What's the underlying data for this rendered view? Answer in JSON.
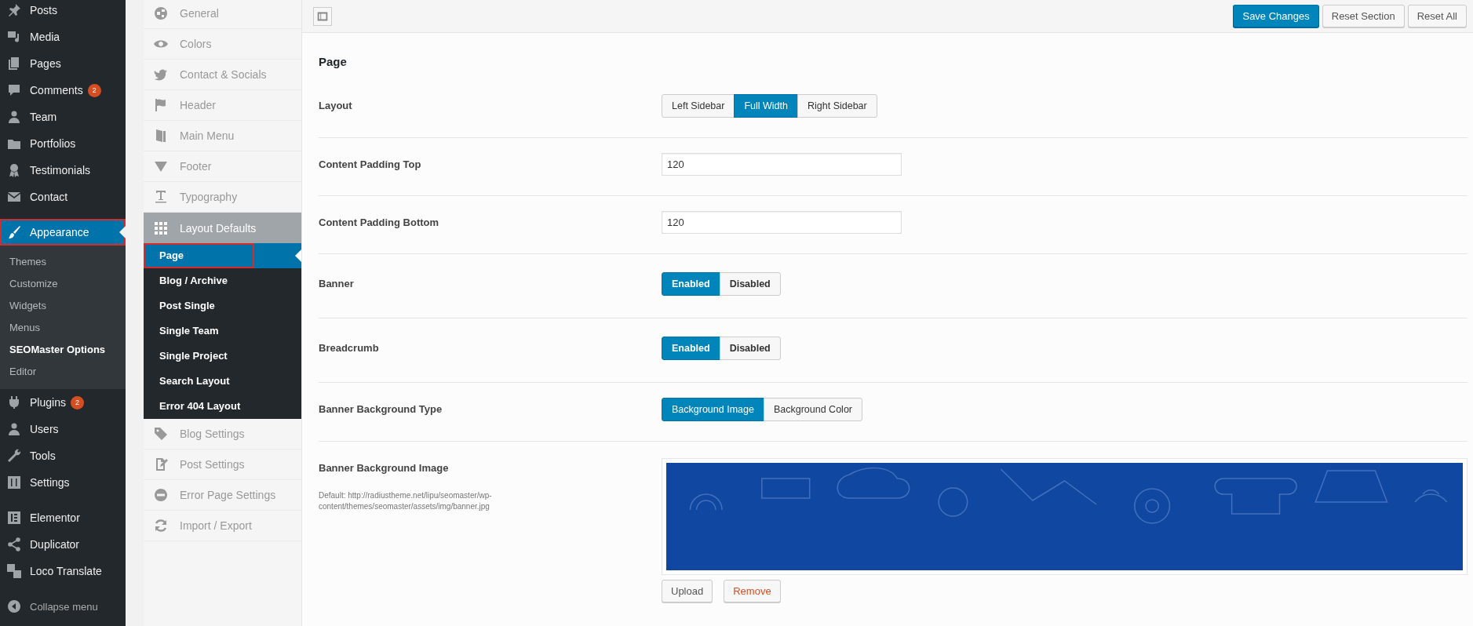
{
  "admin_menu": {
    "groups": [
      [
        {
          "label": "Posts",
          "selected": false
        },
        {
          "label": "Media",
          "selected": false
        },
        {
          "label": "Pages",
          "selected": false
        },
        {
          "label": "Comments",
          "badge": "2",
          "selected": false
        },
        {
          "label": "Team",
          "selected": false
        },
        {
          "label": "Portfolios",
          "selected": false
        },
        {
          "label": "Testimonials",
          "selected": false
        },
        {
          "label": "Contact",
          "selected": false
        }
      ],
      [
        {
          "label": "Appearance",
          "selected": true,
          "highlighted": true,
          "submenu": [
            {
              "label": "Themes",
              "selected": false
            },
            {
              "label": "Customize",
              "selected": false
            },
            {
              "label": "Widgets",
              "selected": false
            },
            {
              "label": "Menus",
              "selected": false
            },
            {
              "label": "SEOMaster Options",
              "selected": true
            },
            {
              "label": "Editor",
              "selected": false
            }
          ]
        },
        {
          "label": "Plugins",
          "badge": "2",
          "selected": false
        },
        {
          "label": "Users",
          "selected": false
        },
        {
          "label": "Tools",
          "selected": false
        },
        {
          "label": "Settings",
          "selected": false
        }
      ],
      [
        {
          "label": "Elementor",
          "selected": false
        },
        {
          "label": "Duplicator",
          "selected": false
        },
        {
          "label": "Loco Translate",
          "selected": false
        }
      ]
    ],
    "collapse": "Collapse menu"
  },
  "options_nav": {
    "items": [
      {
        "label": "General",
        "expanded": false
      },
      {
        "label": "Colors",
        "expanded": false
      },
      {
        "label": "Contact & Socials",
        "expanded": false
      },
      {
        "label": "Header",
        "expanded": false
      },
      {
        "label": "Main Menu",
        "expanded": false
      },
      {
        "label": "Footer",
        "expanded": false
      },
      {
        "label": "Typography",
        "expanded": false
      },
      {
        "label": "Layout Defaults",
        "expanded": true,
        "children": [
          {
            "label": "Page",
            "selected": true,
            "highlighted": true
          },
          {
            "label": "Blog / Archive",
            "selected": false
          },
          {
            "label": "Post Single",
            "selected": false
          },
          {
            "label": "Single Team",
            "selected": false
          },
          {
            "label": "Single Project",
            "selected": false
          },
          {
            "label": "Search Layout",
            "selected": false
          },
          {
            "label": "Error 404 Layout",
            "selected": false
          }
        ]
      },
      {
        "label": "Blog Settings",
        "expanded": false
      },
      {
        "label": "Post Settings",
        "expanded": false
      },
      {
        "label": "Error Page Settings",
        "expanded": false
      },
      {
        "label": "Import / Export",
        "expanded": false
      }
    ]
  },
  "toolbar": {
    "buttons": [
      {
        "label": "Save Changes",
        "kind": "primary"
      },
      {
        "label": "Reset Section",
        "kind": "secondary"
      },
      {
        "label": "Reset All",
        "kind": "secondary"
      }
    ]
  },
  "section": {
    "title": "Page",
    "fields": [
      {
        "kind": "buttonset",
        "label": "Layout",
        "options": [
          {
            "label": "Left Sidebar",
            "selected": false
          },
          {
            "label": "Full Width",
            "selected": true
          },
          {
            "label": "Right Sidebar",
            "selected": false
          }
        ]
      },
      {
        "kind": "text",
        "label": "Content Padding Top",
        "value": "120"
      },
      {
        "kind": "text",
        "label": "Content Padding Bottom",
        "value": "120"
      },
      {
        "kind": "switch",
        "label": "Banner",
        "options": [
          {
            "label": "Enabled",
            "selected": true
          },
          {
            "label": "Disabled",
            "selected": false
          }
        ]
      },
      {
        "kind": "switch",
        "label": "Breadcrumb",
        "options": [
          {
            "label": "Enabled",
            "selected": true
          },
          {
            "label": "Disabled",
            "selected": false
          }
        ]
      },
      {
        "kind": "buttonset",
        "label": "Banner Background Type",
        "options": [
          {
            "label": "Background Image",
            "selected": true
          },
          {
            "label": "Background Color",
            "selected": false
          }
        ]
      },
      {
        "label": "Banner Background Image",
        "description": "Default: http://radiustheme.net/lipu/seomaster/wp-content/themes/seomaster/assets/img/banner.jpg",
        "buttons": [
          {
            "label": "Upload",
            "kind": "upload"
          },
          {
            "label": "Remove",
            "kind": "remove"
          }
        ]
      }
    ]
  }
}
